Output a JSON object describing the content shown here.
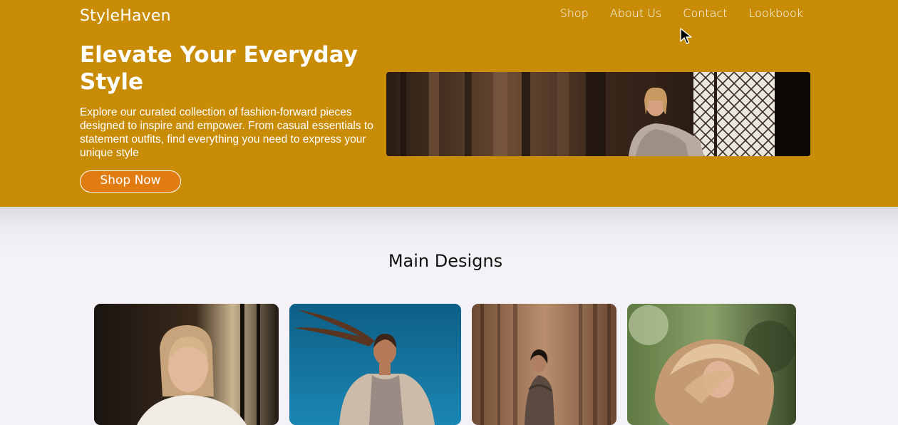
{
  "header": {
    "brand": "StyleHaven",
    "nav": [
      {
        "label": "Shop"
      },
      {
        "label": "About Us"
      },
      {
        "label": "Contact"
      },
      {
        "label": "Lookbook"
      }
    ]
  },
  "hero": {
    "title": "Elevate Your Everyday Style",
    "description": "Explore our curated collection of fashion-forward pieces designed to inspire and empower. From casual essentials to statement outfits, find everything you need to express your unique style",
    "cta_label": "Shop Now"
  },
  "designs": {
    "title": "Main Designs"
  },
  "colors": {
    "hero_background": "#c88c06",
    "cta_background": "#e17c12",
    "page_background": "#f4f2f6"
  }
}
